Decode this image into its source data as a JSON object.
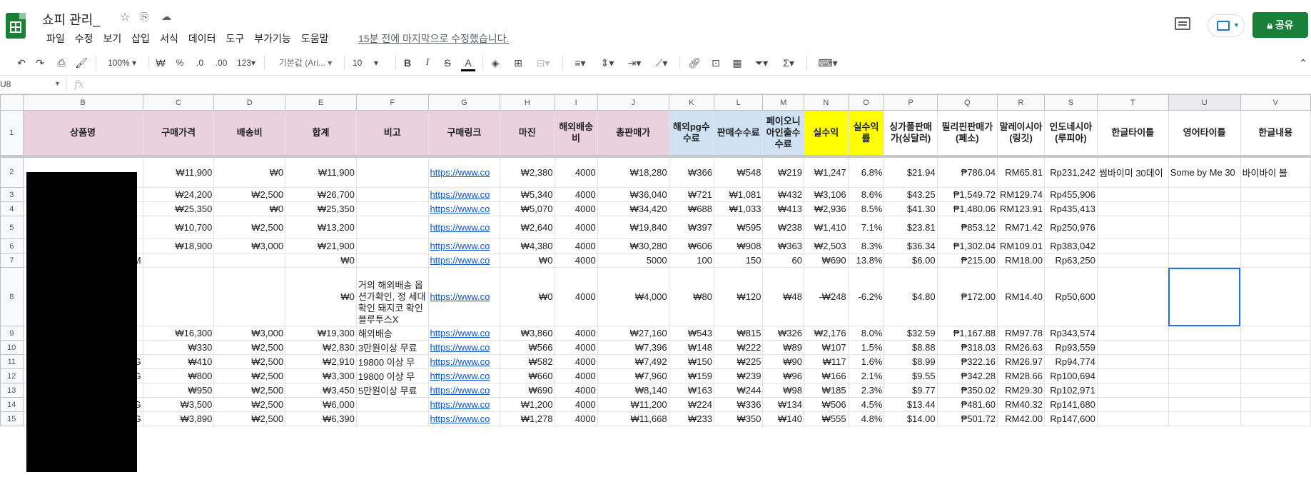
{
  "app": {
    "title": "쇼피 관리_",
    "menus": [
      "파일",
      "수정",
      "보기",
      "삽입",
      "서식",
      "데이터",
      "도구",
      "부가기능",
      "도움말"
    ],
    "last_edit": "15분 전에 마지막으로 수정했습니다.",
    "share_label": "공유",
    "brand_color": "#188038",
    "icons": [
      "star-icon",
      "move-folder-icon",
      "cloud-status-icon",
      "comment-history-icon",
      "present-icon"
    ]
  },
  "toolbar": {
    "zoom": "100%",
    "currency": "₩",
    "percent": "%",
    "dec_decrease": ".0",
    "dec_increase": ".00",
    "format_more": "123",
    "font": "기본값 (Ari...",
    "font_size": "10",
    "bold": "B",
    "italic": "I",
    "strike": "S",
    "text_color": "A",
    "function": "Σ"
  },
  "formula": {
    "cell_ref": "U8",
    "fx": "fx"
  },
  "columns": [
    "B",
    "C",
    "D",
    "E",
    "F",
    "G",
    "H",
    "I",
    "J",
    "K",
    "L",
    "M",
    "N",
    "O",
    "P",
    "Q",
    "R",
    "S",
    "T",
    "U",
    "V"
  ],
  "headers": [
    "상품명",
    "구매가격",
    "배송비",
    "합계",
    "비고",
    "구매링크",
    "마진",
    "해외배송비",
    "총판매가",
    "해외pg수수료",
    "판매수수료",
    "페이오니아인출수수료",
    "실수익",
    "실수익률",
    "싱가폴판매가(싱달러)",
    "필리핀판매가(페소)",
    "말레이시아(링깃)",
    "인도네시아(루피아)",
    "한글타이틀",
    "영어타이틀",
    "한글내용"
  ],
  "header_colors": {
    "pink": "#ead1dc",
    "blue": "#cfe2f3",
    "yellow": "#ffff00"
  },
  "rows": [
    {
      "n": "1"
    },
    {
      "n": "2",
      "cells": [
        "",
        "₩11,900",
        "₩0",
        "₩11,900",
        "",
        "https://www.co",
        "₩2,380",
        "4000",
        "₩18,280",
        "₩366",
        "₩548",
        "₩219",
        "₩1,247",
        "6.8%",
        "$21.94",
        "₱786.04",
        "RM65.81",
        "Rp231,242",
        "썸바이미 30데이",
        "Some by Me 30",
        "바이바이 블"
      ]
    },
    {
      "n": "3",
      "cells": [
        "",
        "₩24,200",
        "₩2,500",
        "₩26,700",
        "",
        "https://www.co",
        "₩5,340",
        "4000",
        "₩36,040",
        "₩721",
        "₩1,081",
        "₩432",
        "₩3,106",
        "8.6%",
        "$43.25",
        "₱1,549.72",
        "RM129.74",
        "Rp455,906",
        "",
        "",
        ""
      ]
    },
    {
      "n": "4",
      "cells": [
        "",
        "₩25,350",
        "₩0",
        "₩25,350",
        "",
        "https://www.co",
        "₩5,070",
        "4000",
        "₩34,420",
        "₩688",
        "₩1,033",
        "₩413",
        "₩2,936",
        "8.5%",
        "$41.30",
        "₱1,480.06",
        "RM123.91",
        "Rp435,413",
        "",
        "",
        ""
      ]
    },
    {
      "n": "5",
      "cells": [
        "",
        "₩10,700",
        "₩2,500",
        "₩13,200",
        "",
        "https://www.co",
        "₩2,640",
        "4000",
        "₩19,840",
        "₩397",
        "₩595",
        "₩238",
        "₩1,410",
        "7.1%",
        "$23.81",
        "₱853.12",
        "RM71.42",
        "Rp250,976",
        "",
        "",
        ""
      ]
    },
    {
      "n": "6",
      "cells": [
        "",
        "₩18,900",
        "₩3,000",
        "₩21,900",
        "",
        "https://www.co",
        "₩4,380",
        "4000",
        "₩30,280",
        "₩606",
        "₩908",
        "₩363",
        "₩2,503",
        "8.3%",
        "$36.34",
        "₱1,302.04",
        "RM109.01",
        "Rp383,042",
        "",
        "",
        ""
      ]
    },
    {
      "n": "7",
      "cells": [
        "M",
        "",
        "",
        "₩0",
        "",
        "https://www.co",
        "₩0",
        "4000",
        "5000",
        "100",
        "150",
        "60",
        "₩690",
        "13.8%",
        "$6.00",
        "₱215.00",
        "RM18.00",
        "Rp63,250",
        "",
        "",
        ""
      ]
    },
    {
      "n": "8",
      "cells": [
        "",
        "",
        "",
        "₩0",
        "거의 해외배송\n옵션가확인, 정\n세대확인\n돼지코 확인\n블루투스X",
        "https://www.co",
        "₩0",
        "4000",
        "₩4,000",
        "₩80",
        "₩120",
        "₩48",
        "-₩248",
        "-6.2%",
        "$4.80",
        "₱172.00",
        "RM14.40",
        "Rp50,600",
        "",
        "",
        ""
      ]
    },
    {
      "n": "9",
      "cells": [
        "",
        "₩16,300",
        "₩3,000",
        "₩19,300",
        "해외배송",
        "https://www.co",
        "₩3,860",
        "4000",
        "₩27,160",
        "₩543",
        "₩815",
        "₩326",
        "₩2,176",
        "8.0%",
        "$32.59",
        "₱1,167.88",
        "RM97.78",
        "Rp343,574",
        "",
        "",
        ""
      ]
    },
    {
      "n": "10",
      "cells": [
        "",
        "₩330",
        "₩2,500",
        "₩2,830",
        "3만원이상 무료",
        "https://www.co",
        "₩566",
        "4000",
        "₩7,396",
        "₩148",
        "₩222",
        "₩89",
        "₩107",
        "1.5%",
        "$8.88",
        "₱318.03",
        "RM26.63",
        "Rp93,559",
        "",
        "",
        ""
      ]
    },
    {
      "n": "11",
      "cells": [
        "G",
        "₩410",
        "₩2,500",
        "₩2,910",
        "19800 이상 무",
        "https://www.co",
        "₩582",
        "4000",
        "₩7,492",
        "₩150",
        "₩225",
        "₩90",
        "₩117",
        "1.6%",
        "$8.99",
        "₱322.16",
        "RM26.97",
        "Rp94,774",
        "",
        "",
        ""
      ]
    },
    {
      "n": "12",
      "cells": [
        "G",
        "₩800",
        "₩2,500",
        "₩3,300",
        "19800 이상 무",
        "https://www.co",
        "₩660",
        "4000",
        "₩7,960",
        "₩159",
        "₩239",
        "₩96",
        "₩166",
        "2.1%",
        "$9.55",
        "₱342.28",
        "RM28.66",
        "Rp100,694",
        "",
        "",
        ""
      ]
    },
    {
      "n": "13",
      "cells": [
        "",
        "₩950",
        "₩2,500",
        "₩3,450",
        "5만원이상 무료",
        "https://www.co",
        "₩690",
        "4000",
        "₩8,140",
        "₩163",
        "₩244",
        "₩98",
        "₩185",
        "2.3%",
        "$9.77",
        "₱350.02",
        "RM29.30",
        "Rp102,971",
        "",
        "",
        ""
      ]
    },
    {
      "n": "14",
      "cells": [
        "G",
        "₩3,500",
        "₩2,500",
        "₩6,000",
        "",
        "https://www.co",
        "₩1,200",
        "4000",
        "₩11,200",
        "₩224",
        "₩336",
        "₩134",
        "₩506",
        "4.5%",
        "$13.44",
        "₱481.60",
        "RM40.32",
        "Rp141,680",
        "",
        "",
        ""
      ]
    },
    {
      "n": "15",
      "cells": [
        "G",
        "₩3,890",
        "₩2,500",
        "₩6,390",
        "",
        "https://www.co",
        "₩1,278",
        "4000",
        "₩11,668",
        "₩233",
        "₩350",
        "₩140",
        "₩555",
        "4.8%",
        "$14.00",
        "₱501.72",
        "RM42.00",
        "Rp147,600",
        "",
        "",
        ""
      ]
    }
  ]
}
